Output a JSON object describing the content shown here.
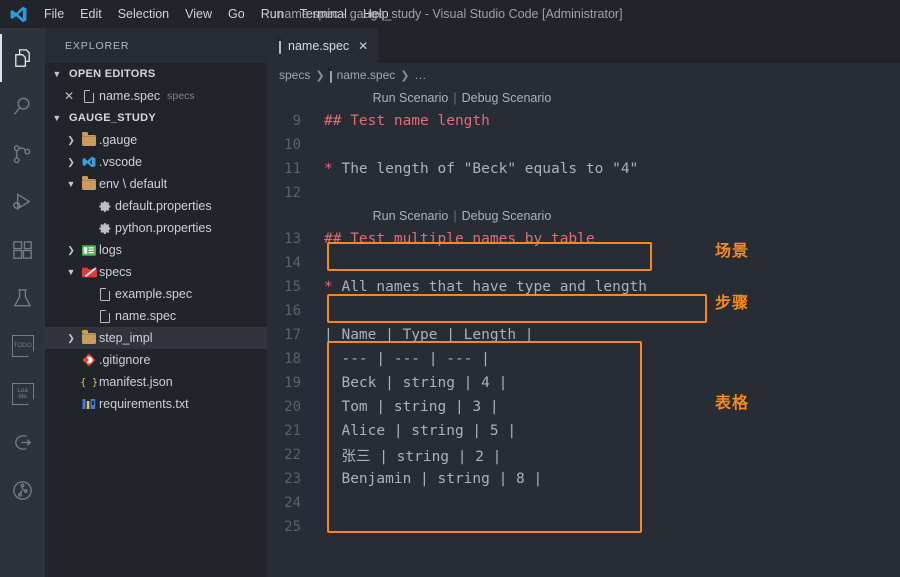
{
  "window": {
    "title": "name.spec - gauge_study - Visual Studio Code [Administrator]",
    "logo_icon": "vscode-logo-icon"
  },
  "menubar": {
    "items": [
      {
        "label": "File"
      },
      {
        "label": "Edit"
      },
      {
        "label": "Selection"
      },
      {
        "label": "View"
      },
      {
        "label": "Go"
      },
      {
        "label": "Run"
      },
      {
        "label": "Terminal"
      },
      {
        "label": "Help"
      }
    ]
  },
  "activitybar": {
    "items": [
      {
        "icon": "files-explorer-icon",
        "label": "Explorer",
        "active": true
      },
      {
        "icon": "search-icon",
        "label": "Search",
        "active": false
      },
      {
        "icon": "source-control-icon",
        "label": "Source Control",
        "active": false
      },
      {
        "icon": "run-and-debug-icon",
        "label": "Run and Debug",
        "active": false
      },
      {
        "icon": "extensions-icon",
        "label": "Extensions",
        "active": false
      },
      {
        "icon": "testing-flask-icon",
        "label": "Testing",
        "active": false
      },
      {
        "icon": "todo-tree-icon",
        "label": "TODO",
        "active": false
      },
      {
        "icon": "lua-ide-icon",
        "label": "Lua Ide",
        "active": false
      },
      {
        "icon": "gauge-icon",
        "label": "Gauge",
        "active": false
      },
      {
        "icon": "timeline-circle-icon",
        "label": "Timeline",
        "active": false
      }
    ],
    "todo_label_top": "TODO",
    "lua_label_top": "Lua",
    "lua_label_bottom": "Ide"
  },
  "sidebar": {
    "header": "EXPLORER",
    "open_editors": {
      "title": "OPEN EDITORS",
      "expanded": true,
      "items": [
        {
          "name": "name.spec",
          "sub": "specs",
          "icon": "file-icon",
          "close": "✕"
        }
      ]
    },
    "project": {
      "title": "GAUGE_STUDY",
      "expanded": true,
      "items": [
        {
          "label": ".gauge",
          "icon": "folder-icon",
          "twisty": "chevron-right",
          "indent": 1,
          "selected": false
        },
        {
          "label": ".vscode",
          "icon": "vscode-folder-icon",
          "twisty": "chevron-right",
          "indent": 1,
          "selected": false
        },
        {
          "label": "env \\ default",
          "icon": "folder-icon",
          "twisty": "chevron-down",
          "indent": 1,
          "selected": false
        },
        {
          "label": "default.properties",
          "icon": "gear-icon",
          "twisty": "",
          "indent": 2,
          "selected": false
        },
        {
          "label": "python.properties",
          "icon": "gear-icon",
          "twisty": "",
          "indent": 2,
          "selected": false
        },
        {
          "label": "logs",
          "icon": "logs-folder-icon",
          "twisty": "chevron-right",
          "indent": 1,
          "selected": false
        },
        {
          "label": "specs",
          "icon": "specs-folder-icon",
          "twisty": "chevron-down",
          "indent": 1,
          "selected": false
        },
        {
          "label": "example.spec",
          "icon": "file-icon",
          "twisty": "",
          "indent": 2,
          "selected": false
        },
        {
          "label": "name.spec",
          "icon": "file-icon",
          "twisty": "",
          "indent": 2,
          "selected": false
        },
        {
          "label": "step_impl",
          "icon": "folder-icon",
          "twisty": "chevron-right",
          "indent": 1,
          "selected": true
        },
        {
          "label": ".gitignore",
          "icon": "git-icon",
          "twisty": "",
          "indent": 1,
          "selected": false
        },
        {
          "label": "manifest.json",
          "icon": "json-icon",
          "twisty": "",
          "indent": 1,
          "selected": false
        },
        {
          "label": "requirements.txt",
          "icon": "requirements-icon",
          "twisty": "",
          "indent": 1,
          "selected": false
        }
      ]
    }
  },
  "editor": {
    "tabs": [
      {
        "label": "name.spec",
        "icon": "file-icon",
        "close": "✕",
        "active": true
      }
    ],
    "breadcrumbs": [
      {
        "label": "specs",
        "icon": ""
      },
      {
        "label": "name.spec",
        "icon": "file-icon"
      },
      {
        "label": "…",
        "icon": ""
      }
    ],
    "codelens": {
      "run": "Run Scenario",
      "separator": "|",
      "debug": "Debug Scenario"
    },
    "lines": [
      {
        "num": "9",
        "kind": "heading",
        "text": "## Test name length"
      },
      {
        "num": "10",
        "kind": "blank",
        "text": ""
      },
      {
        "num": "11",
        "kind": "step",
        "text": "* The length of \"Beck\" equals to \"4\""
      },
      {
        "num": "12",
        "kind": "blank",
        "text": ""
      },
      {
        "num": "13",
        "kind": "heading",
        "text": "## Test multiple names by table"
      },
      {
        "num": "14",
        "kind": "blank",
        "text": ""
      },
      {
        "num": "15",
        "kind": "step",
        "text": "* All names that have type and length"
      },
      {
        "num": "16",
        "kind": "blank",
        "text": ""
      },
      {
        "num": "17",
        "kind": "table",
        "text": "| Name | Type | Length |"
      },
      {
        "num": "18",
        "kind": "table",
        "text": "| --- | --- | --- |"
      },
      {
        "num": "19",
        "kind": "table",
        "text": "| Beck | string | 4 |"
      },
      {
        "num": "20",
        "kind": "table",
        "text": "| Tom | string | 3 |"
      },
      {
        "num": "21",
        "kind": "table",
        "text": "| Alice | string | 5 |"
      },
      {
        "num": "22",
        "kind": "table",
        "text": "| 张三 | string | 2 |"
      },
      {
        "num": "23",
        "kind": "table",
        "text": "| Benjamin | string | 8 |"
      },
      {
        "num": "24",
        "kind": "blank",
        "text": ""
      },
      {
        "num": "25",
        "kind": "blank",
        "text": ""
      }
    ]
  },
  "annotations": {
    "accent_color": "#f5881f",
    "labels": [
      {
        "text": "场景",
        "meaning": "scenario"
      },
      {
        "text": "步骤",
        "meaning": "step"
      },
      {
        "text": "表格",
        "meaning": "table"
      }
    ]
  },
  "colors": {
    "editor_background": "#282c34",
    "sidebar_background": "#21252b",
    "activitybar_background": "#2d323b",
    "heading_text": "#e06c75",
    "body_text": "#a9b2c0",
    "line_number": "#5a6170",
    "annotation_orange": "#f5881f"
  }
}
